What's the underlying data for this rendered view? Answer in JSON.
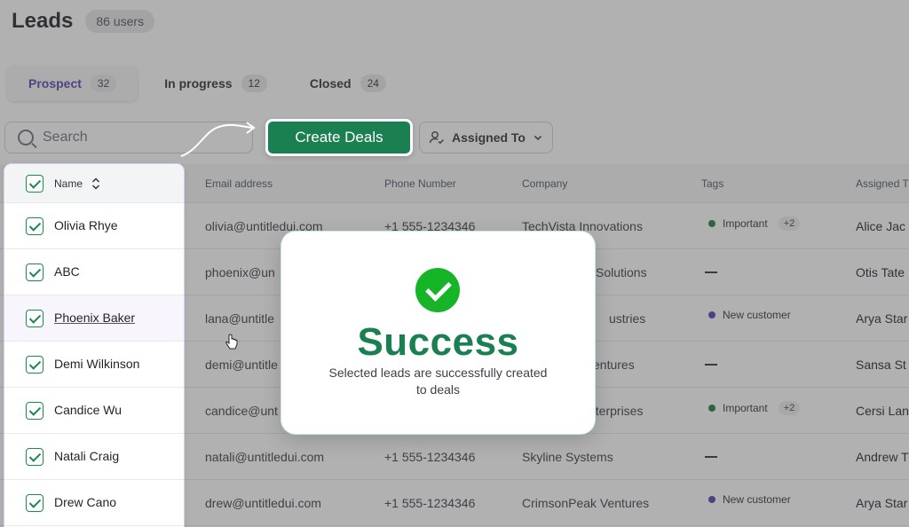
{
  "header": {
    "title": "Leads",
    "users_badge": "86 users"
  },
  "tabs": [
    {
      "label": "Prospect",
      "count": "32"
    },
    {
      "label": "In progress",
      "count": "12"
    },
    {
      "label": "Closed",
      "count": "24"
    }
  ],
  "search": {
    "placeholder": "Search"
  },
  "toolbar": {
    "create_label": "Create Deals",
    "assigned_label": "Assigned To"
  },
  "table": {
    "columns": [
      "Name",
      "Email address",
      "Phone Number",
      "Company",
      "Tags",
      "Assigned T"
    ],
    "rows": [
      {
        "name": "Olivia Rhye",
        "email": "olivia@untitledui.com",
        "phone": "+1 555-1234346",
        "company": "TechVista Innovations",
        "tag": "Important",
        "tag_extra": "+2",
        "assigned": "Alice Jac"
      },
      {
        "name": "ABC",
        "email": "phoenix@un",
        "phone": "",
        "company": "Solutions",
        "tag": "",
        "tag_extra": "",
        "assigned": "Otis Tate"
      },
      {
        "name": "Phoenix Baker",
        "email": "lana@untitle",
        "phone": "",
        "company": "ustries",
        "tag": "New customer",
        "tag_extra": "",
        "assigned": "Arya Star"
      },
      {
        "name": "Demi Wilkinson",
        "email": "demi@untitle",
        "phone": "",
        "company": "entures",
        "tag": "",
        "tag_extra": "",
        "assigned": "Sansa St"
      },
      {
        "name": "Candice Wu",
        "email": "candice@unt",
        "phone": "",
        "company": "nterprises",
        "tag": "Important",
        "tag_extra": "+2",
        "assigned": "Cersi Lan"
      },
      {
        "name": "Natali Craig",
        "email": "natali@untitledui.com",
        "phone": "+1 555-1234346",
        "company": "Skyline Systems",
        "tag": "",
        "tag_extra": "",
        "assigned": "Andrew T"
      },
      {
        "name": "Drew Cano",
        "email": "drew@untitledui.com",
        "phone": "+1 555-1234346",
        "company": "CrimsonPeak Ventures",
        "tag": "New customer",
        "tag_extra": "",
        "assigned": "Arya Star"
      }
    ]
  },
  "colors": {
    "accent_green": "#1a7f51",
    "success_check": "#15b527",
    "tag_important": "#15803d",
    "tag_new": "#5b3fb0",
    "tab_active": "#5b3fb0"
  },
  "modal": {
    "title": "Success",
    "message": "Selected leads are successfully created to deals"
  }
}
